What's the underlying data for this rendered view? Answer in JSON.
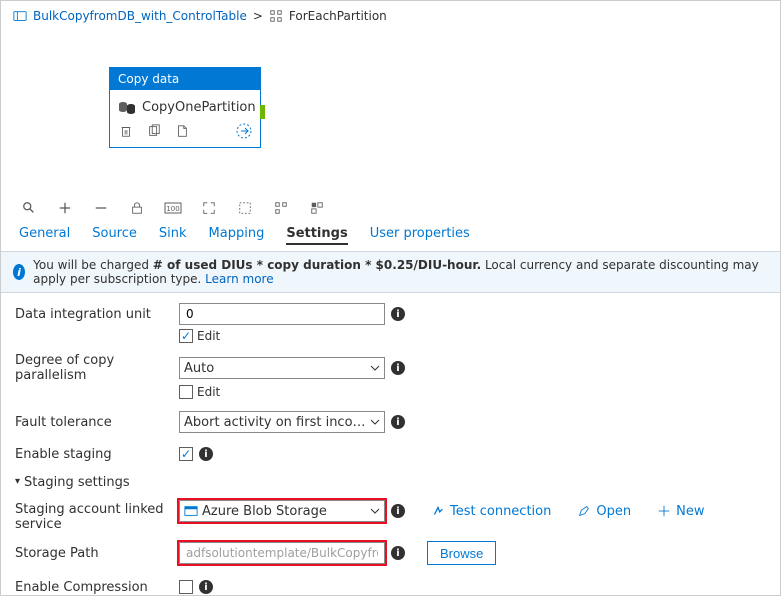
{
  "breadcrumb": {
    "root_label": "BulkCopyfromDB_with_ControlTable",
    "current_label": "ForEachPartition"
  },
  "activity": {
    "header": "Copy data",
    "name": "CopyOnePartition"
  },
  "tabs": {
    "general": "General",
    "source": "Source",
    "sink": "Sink",
    "mapping": "Mapping",
    "settings": "Settings",
    "user_properties": "User properties"
  },
  "banner": {
    "prefix": "You will be charged ",
    "bold": "# of used DIUs * copy duration * $0.25/DIU-hour.",
    "suffix": " Local currency and separate discounting may apply per subscription type. ",
    "link": "Learn more"
  },
  "form": {
    "diu_label": "Data integration unit",
    "diu_value": "0",
    "edit_label": "Edit",
    "parallelism_label": "Degree of copy parallelism",
    "parallelism_value": "Auto",
    "fault_label": "Fault tolerance",
    "fault_value": "Abort activity on first incompatible row",
    "staging_enable_label": "Enable staging",
    "staging_settings_label": "Staging settings",
    "linked_service_label": "Staging account linked service",
    "linked_service_value": "Azure Blob Storage",
    "storage_path_label": "Storage Path",
    "storage_path_value": "adfsolutiontemplate/BulkCopyfromDB_with_Co",
    "browse_label": "Browse",
    "test_conn_label": "Test connection",
    "open_label": "Open",
    "new_label": "New",
    "compression_label": "Enable Compression"
  }
}
